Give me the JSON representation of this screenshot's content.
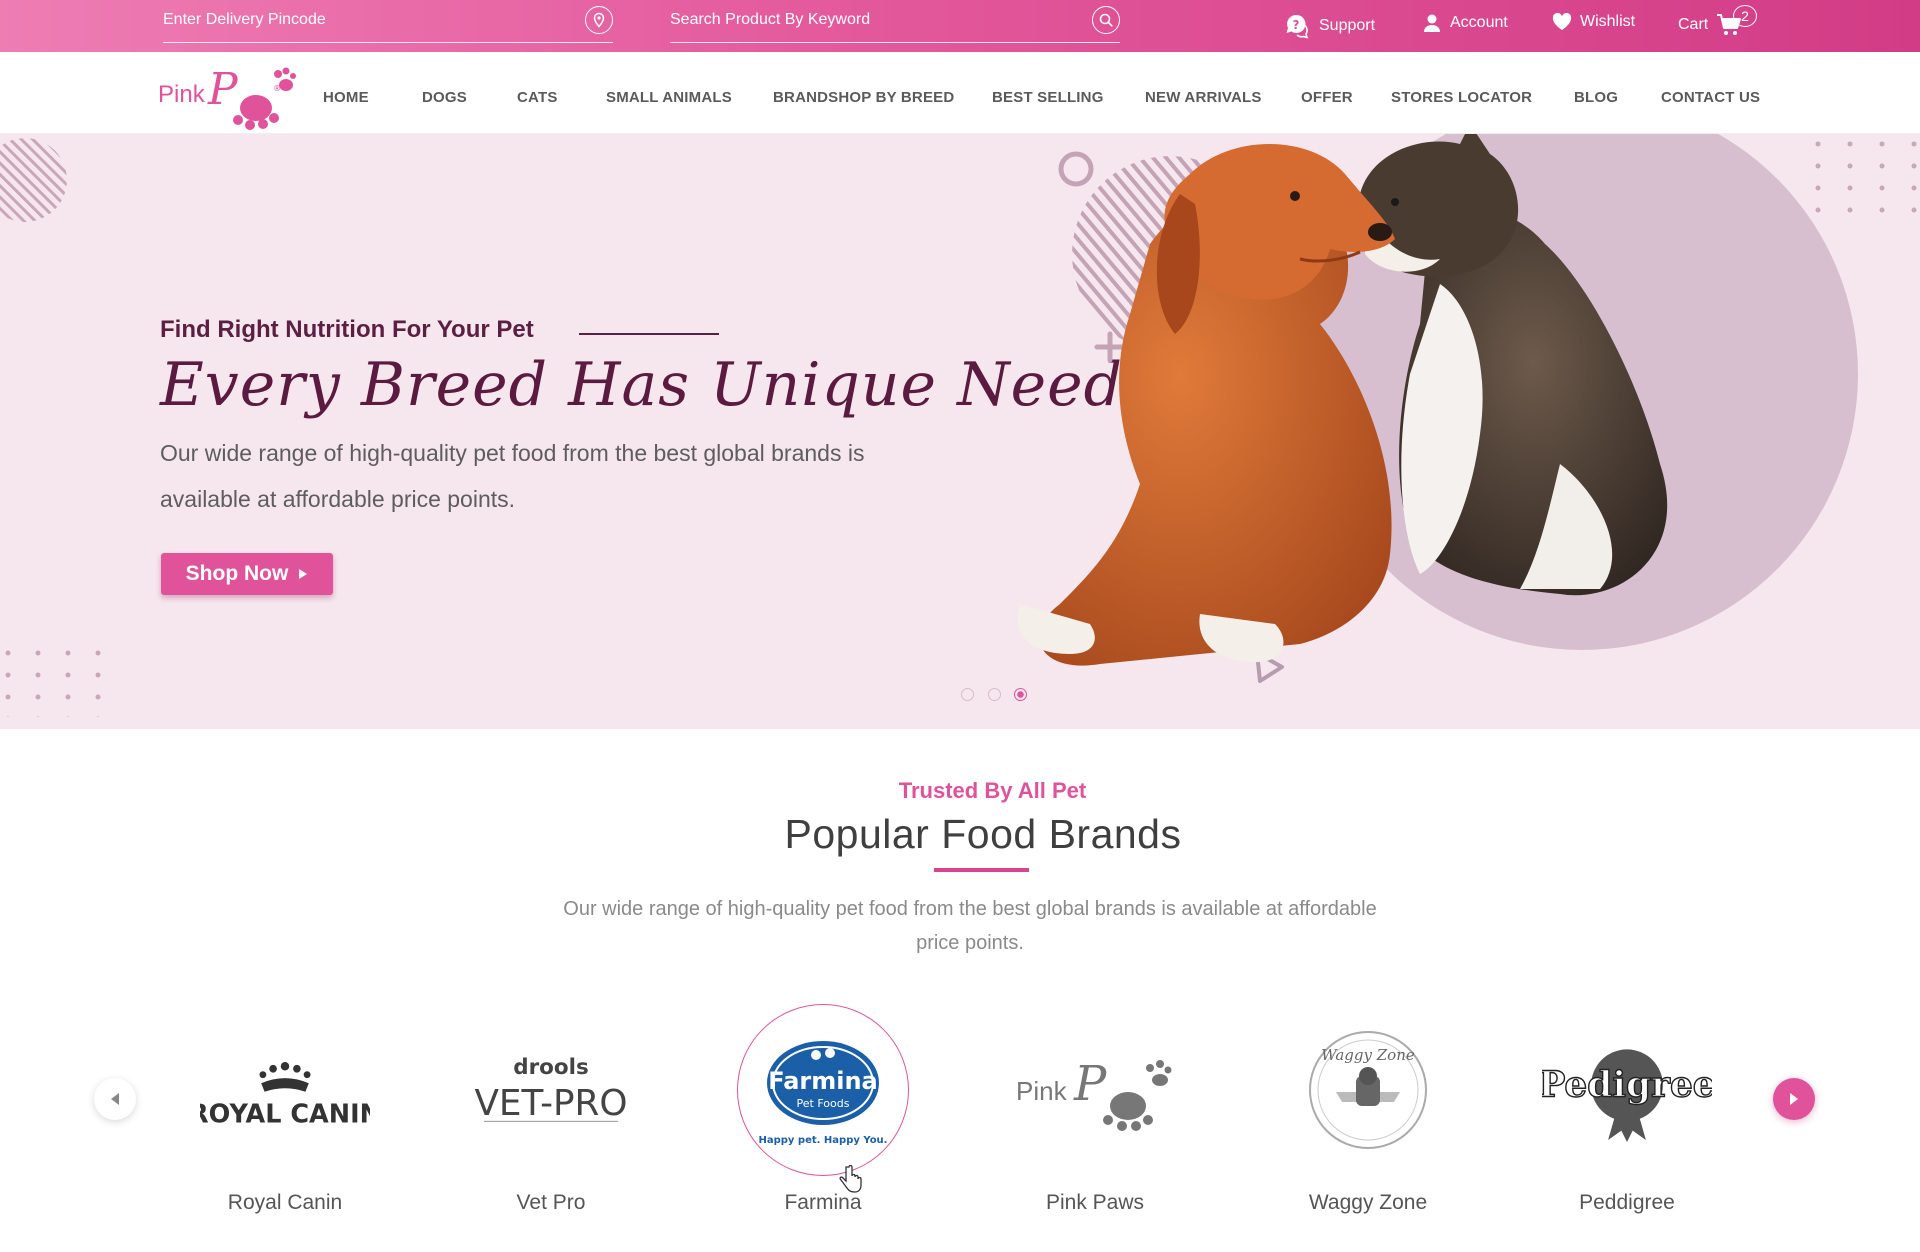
{
  "topbar": {
    "pincode_placeholder": "Enter Delivery Pincode",
    "search_placeholder": "Search Product By Keyword",
    "support": "Support",
    "account": "Account",
    "wishlist": "Wishlist",
    "cart": "Cart",
    "cart_count": "2"
  },
  "logo": {
    "text_pink": "Pink",
    "text_paws": "Paws"
  },
  "nav": {
    "items": [
      "HOME",
      "DOGS",
      "CATS",
      "SMALL ANIMALS",
      "BRANDSHOP BY BREED",
      "BEST SELLING",
      "NEW ARRIVALS",
      "OFFER",
      "STORES LOCATOR",
      "BLOG",
      "CONTACT US"
    ]
  },
  "hero": {
    "kicker": "Find Right Nutrition For Your Pet",
    "title": "Every Breed Has Unique Needs",
    "description": "Our wide range of high-quality pet food from the best global brands is available at affordable price points.",
    "cta": "Shop Now",
    "slides": 3,
    "active_slide": 3
  },
  "brands": {
    "kicker": "Trusted By All Pet",
    "title": "Popular Food Brands",
    "description": "Our wide range of high-quality pet food from the best global brands is available at affordable price points.",
    "items": [
      {
        "name": "Royal Canin",
        "logo_text": "ROYAL CANIN"
      },
      {
        "name": "Vet Pro",
        "logo_text": "VET-PRO",
        "logo_sub": "drools"
      },
      {
        "name": "Farmina",
        "logo_text": "Farmina",
        "logo_sub": "Pet Foods",
        "logo_tag": "Happy pet. Happy You."
      },
      {
        "name": "Pink Paws",
        "logo_text": "PinkPaws"
      },
      {
        "name": "Waggy Zone",
        "logo_text": "Waggy Zone"
      },
      {
        "name": "Peddigree",
        "logo_text": "Pedigree"
      }
    ]
  },
  "colors": {
    "brand_pink": "#e0539a",
    "hero_bg": "#f6e7ee",
    "title_plum": "#5b1a3f"
  }
}
